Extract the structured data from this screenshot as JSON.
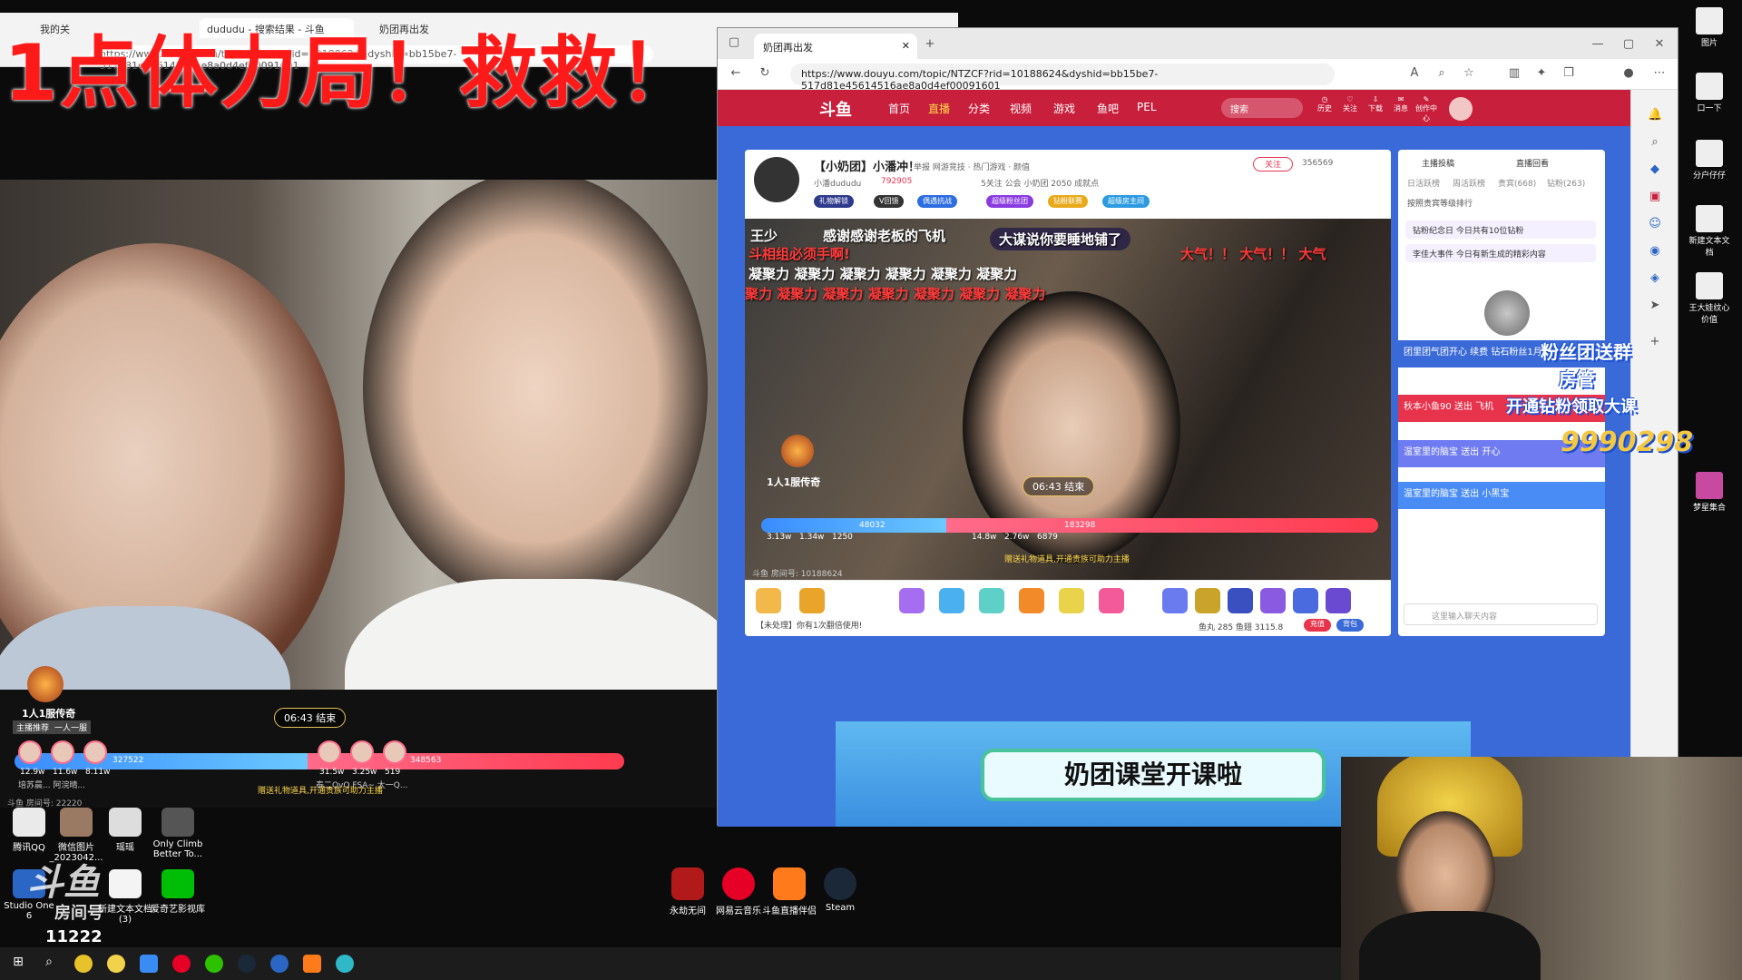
{
  "overlay_title": "1点体力局！救救！",
  "bg_browser": {
    "tabs": [
      "我的关",
      "dududu - 搜索结果 - 斗鱼",
      "奶团再出发"
    ],
    "url": "https://www.douyu.com/topic/NTZCF?rid=10188624&dyshid=bb15be7-517d81e45614516ae8a0d4ef00091601"
  },
  "left_stream": {
    "master": "1人1服传奇",
    "tags": [
      "主播推荐",
      "一人一服"
    ],
    "timer": "06:43 结束",
    "left_score": "327522",
    "right_score": "348563",
    "left_fans": [
      "12.9w",
      "11.6w",
      "8.11w"
    ],
    "right_fans": [
      "31.5w",
      "3.25w",
      "519"
    ],
    "left_names": "培苏晨...  阿浣晴...",
    "right_names": "泰二QvQ  FSA~  太一Q...",
    "notice": "赠送礼物道具,开通贵族可助力主播",
    "room_no": "斗鱼 房间号: 22220"
  },
  "desktop_icons_left": [
    {
      "label": "腾讯QQ",
      "color": "#eaeaea"
    },
    {
      "label": "微信图片_2023042...",
      "color": "#9b7a63"
    },
    {
      "label": "瑶瑶",
      "color": "#ddd"
    },
    {
      "label": "Only Climb Better To...",
      "color": "#555"
    },
    {
      "label": "Studio One 6",
      "color": "#2b66c4"
    },
    {
      "label": "新建文本文档 (3)",
      "color": "#f4f4f4"
    },
    {
      "label": "爱奇艺影视库",
      "color": "#00be06"
    }
  ],
  "dock_icons": [
    {
      "label": "永劫无间",
      "color": "#b21a1a"
    },
    {
      "label": "网易云音乐",
      "color": "#e60026"
    },
    {
      "label": "斗鱼直播伴侣",
      "color": "#ff7a1a"
    },
    {
      "label": "Steam",
      "color": "#1b2838"
    }
  ],
  "right_desktop_icons": [
    "图片",
    "口一下",
    "分户仔仔",
    "新建文本文档",
    "王大娃纹心价值",
    "梦星集合"
  ],
  "douyu_watermark": "斗鱼",
  "watermark_room": "房间号",
  "viewer_count": "11222",
  "main_browser": {
    "tab_title": "奶团再出发",
    "url": "https://www.douyu.com/topic/NTZCF?rid=10188624&dyshid=bb15be7-517d81e45614516ae8a0d4ef00091601"
  },
  "douyu": {
    "logo": "斗鱼",
    "nav": [
      "首页",
      "直播",
      "分类",
      "视频",
      "游戏",
      "鱼吧",
      "PEL"
    ],
    "search_placeholder": "搜索",
    "nav_icons": [
      "历史",
      "关注",
      "下载",
      "消息",
      "创作中心"
    ],
    "room_title": "【小奶团】小潘冲！",
    "room_meta": "举报  网游竞技 · 热门游戏 · 颜值",
    "streamer": "小潘dududu",
    "hot": "792905",
    "follow_btn": "关注",
    "follow_count": "356569",
    "stats": "5关注  公会  小奶团  2050 成就点",
    "tags": [
      "礼物解锁",
      "V回馈",
      "偶遇抗战",
      "超级粉丝团",
      "钻粉联赛",
      "超级房主间"
    ],
    "danmu": [
      {
        "text": "王少",
        "red": false
      },
      {
        "text": "感谢感谢老板的飞机",
        "red": false
      },
      {
        "text": "大谋说你要睡地铺了",
        "red": false
      },
      {
        "text": "斗相组必须手啊!",
        "red": true
      },
      {
        "text": "凝聚力 凝聚力 凝聚力 凝聚力 凝聚力 凝聚力",
        "red": false
      },
      {
        "text": "聚力 凝聚力 凝聚力 凝聚力 凝聚力 凝聚力 凝聚力",
        "red": true
      },
      {
        "text": "大气！！ 大气！！ 大气",
        "red": true
      }
    ],
    "pk_master": "1人1服传奇",
    "pk_timer": "06:43 结束",
    "pk_left": "48032",
    "pk_right": "183298",
    "pk_left_fans": [
      "3.13w",
      "1.34w",
      "1250"
    ],
    "pk_right_fans": [
      "14.8w",
      "2.76w",
      "6879"
    ],
    "pk_notice": "赠送礼物道具,开通贵族可助力主播",
    "room_no": "斗鱼 房间号: 10188624",
    "gift_notice": "【未处理】你有1次翻倍使用!",
    "balance": "鱼丸 285   鱼翅 3115.8",
    "recharge": "充值",
    "backpack": "背包",
    "side_tabs": [
      "主播投稿",
      "直播回看"
    ],
    "side_sub_tabs": [
      "日活跃榜",
      "周活跃榜",
      "贵宾(668)",
      "钻粉(263)"
    ],
    "rank_title": "按照贵宾等级排行",
    "rank_rows": [
      "钻粉纪念日  今日共有10位钻粉",
      "李佳大事件  今日有新生成的精彩内容"
    ],
    "chat_rows": [
      {
        "text": "团里团气团开心  续费 钻石粉丝1月",
        "color": "#3a6ad8"
      },
      {
        "text": "秋本小鱼90  送出 飞机",
        "color": "#e8334d"
      },
      {
        "text": "温室里的脑宝  送出 开心",
        "color": "#6f7bf0"
      },
      {
        "text": "温室里的脑宝  送出 小黑宝",
        "color": "#4a8cf5"
      }
    ],
    "chat_placeholder": "这里输入聊天内容",
    "course_banner": "奶团课堂开课啦"
  },
  "right_overlay": {
    "line1": "粉丝团送群",
    "line2": "房管",
    "line3": "开通钻粉领取大课",
    "gold_number": "9990298"
  }
}
